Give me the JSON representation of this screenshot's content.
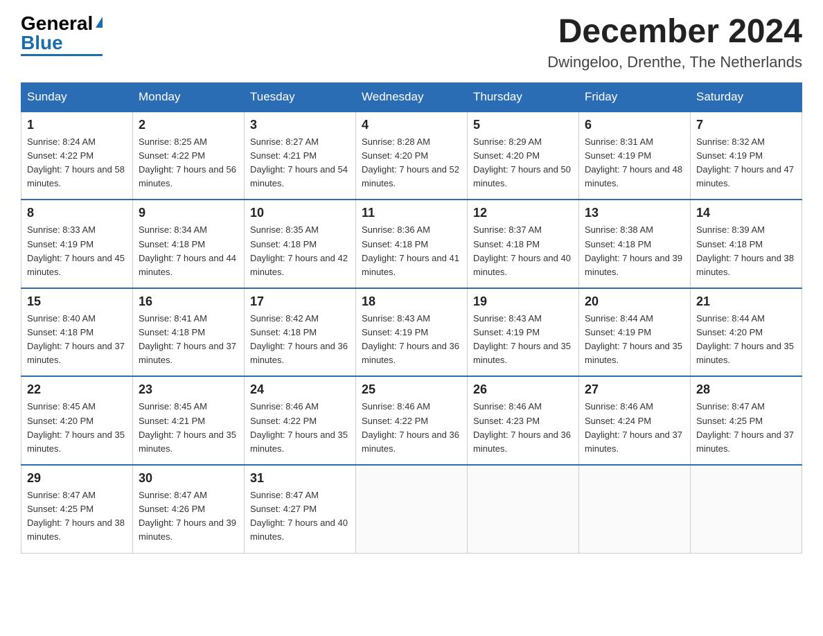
{
  "header": {
    "logo_general": "General",
    "logo_blue": "Blue",
    "month_year": "December 2024",
    "location": "Dwingeloo, Drenthe, The Netherlands"
  },
  "days_of_week": [
    "Sunday",
    "Monday",
    "Tuesday",
    "Wednesday",
    "Thursday",
    "Friday",
    "Saturday"
  ],
  "weeks": [
    [
      {
        "num": "1",
        "sunrise": "Sunrise: 8:24 AM",
        "sunset": "Sunset: 4:22 PM",
        "daylight": "Daylight: 7 hours and 58 minutes."
      },
      {
        "num": "2",
        "sunrise": "Sunrise: 8:25 AM",
        "sunset": "Sunset: 4:22 PM",
        "daylight": "Daylight: 7 hours and 56 minutes."
      },
      {
        "num": "3",
        "sunrise": "Sunrise: 8:27 AM",
        "sunset": "Sunset: 4:21 PM",
        "daylight": "Daylight: 7 hours and 54 minutes."
      },
      {
        "num": "4",
        "sunrise": "Sunrise: 8:28 AM",
        "sunset": "Sunset: 4:20 PM",
        "daylight": "Daylight: 7 hours and 52 minutes."
      },
      {
        "num": "5",
        "sunrise": "Sunrise: 8:29 AM",
        "sunset": "Sunset: 4:20 PM",
        "daylight": "Daylight: 7 hours and 50 minutes."
      },
      {
        "num": "6",
        "sunrise": "Sunrise: 8:31 AM",
        "sunset": "Sunset: 4:19 PM",
        "daylight": "Daylight: 7 hours and 48 minutes."
      },
      {
        "num": "7",
        "sunrise": "Sunrise: 8:32 AM",
        "sunset": "Sunset: 4:19 PM",
        "daylight": "Daylight: 7 hours and 47 minutes."
      }
    ],
    [
      {
        "num": "8",
        "sunrise": "Sunrise: 8:33 AM",
        "sunset": "Sunset: 4:19 PM",
        "daylight": "Daylight: 7 hours and 45 minutes."
      },
      {
        "num": "9",
        "sunrise": "Sunrise: 8:34 AM",
        "sunset": "Sunset: 4:18 PM",
        "daylight": "Daylight: 7 hours and 44 minutes."
      },
      {
        "num": "10",
        "sunrise": "Sunrise: 8:35 AM",
        "sunset": "Sunset: 4:18 PM",
        "daylight": "Daylight: 7 hours and 42 minutes."
      },
      {
        "num": "11",
        "sunrise": "Sunrise: 8:36 AM",
        "sunset": "Sunset: 4:18 PM",
        "daylight": "Daylight: 7 hours and 41 minutes."
      },
      {
        "num": "12",
        "sunrise": "Sunrise: 8:37 AM",
        "sunset": "Sunset: 4:18 PM",
        "daylight": "Daylight: 7 hours and 40 minutes."
      },
      {
        "num": "13",
        "sunrise": "Sunrise: 8:38 AM",
        "sunset": "Sunset: 4:18 PM",
        "daylight": "Daylight: 7 hours and 39 minutes."
      },
      {
        "num": "14",
        "sunrise": "Sunrise: 8:39 AM",
        "sunset": "Sunset: 4:18 PM",
        "daylight": "Daylight: 7 hours and 38 minutes."
      }
    ],
    [
      {
        "num": "15",
        "sunrise": "Sunrise: 8:40 AM",
        "sunset": "Sunset: 4:18 PM",
        "daylight": "Daylight: 7 hours and 37 minutes."
      },
      {
        "num": "16",
        "sunrise": "Sunrise: 8:41 AM",
        "sunset": "Sunset: 4:18 PM",
        "daylight": "Daylight: 7 hours and 37 minutes."
      },
      {
        "num": "17",
        "sunrise": "Sunrise: 8:42 AM",
        "sunset": "Sunset: 4:18 PM",
        "daylight": "Daylight: 7 hours and 36 minutes."
      },
      {
        "num": "18",
        "sunrise": "Sunrise: 8:43 AM",
        "sunset": "Sunset: 4:19 PM",
        "daylight": "Daylight: 7 hours and 36 minutes."
      },
      {
        "num": "19",
        "sunrise": "Sunrise: 8:43 AM",
        "sunset": "Sunset: 4:19 PM",
        "daylight": "Daylight: 7 hours and 35 minutes."
      },
      {
        "num": "20",
        "sunrise": "Sunrise: 8:44 AM",
        "sunset": "Sunset: 4:19 PM",
        "daylight": "Daylight: 7 hours and 35 minutes."
      },
      {
        "num": "21",
        "sunrise": "Sunrise: 8:44 AM",
        "sunset": "Sunset: 4:20 PM",
        "daylight": "Daylight: 7 hours and 35 minutes."
      }
    ],
    [
      {
        "num": "22",
        "sunrise": "Sunrise: 8:45 AM",
        "sunset": "Sunset: 4:20 PM",
        "daylight": "Daylight: 7 hours and 35 minutes."
      },
      {
        "num": "23",
        "sunrise": "Sunrise: 8:45 AM",
        "sunset": "Sunset: 4:21 PM",
        "daylight": "Daylight: 7 hours and 35 minutes."
      },
      {
        "num": "24",
        "sunrise": "Sunrise: 8:46 AM",
        "sunset": "Sunset: 4:22 PM",
        "daylight": "Daylight: 7 hours and 35 minutes."
      },
      {
        "num": "25",
        "sunrise": "Sunrise: 8:46 AM",
        "sunset": "Sunset: 4:22 PM",
        "daylight": "Daylight: 7 hours and 36 minutes."
      },
      {
        "num": "26",
        "sunrise": "Sunrise: 8:46 AM",
        "sunset": "Sunset: 4:23 PM",
        "daylight": "Daylight: 7 hours and 36 minutes."
      },
      {
        "num": "27",
        "sunrise": "Sunrise: 8:46 AM",
        "sunset": "Sunset: 4:24 PM",
        "daylight": "Daylight: 7 hours and 37 minutes."
      },
      {
        "num": "28",
        "sunrise": "Sunrise: 8:47 AM",
        "sunset": "Sunset: 4:25 PM",
        "daylight": "Daylight: 7 hours and 37 minutes."
      }
    ],
    [
      {
        "num": "29",
        "sunrise": "Sunrise: 8:47 AM",
        "sunset": "Sunset: 4:25 PM",
        "daylight": "Daylight: 7 hours and 38 minutes."
      },
      {
        "num": "30",
        "sunrise": "Sunrise: 8:47 AM",
        "sunset": "Sunset: 4:26 PM",
        "daylight": "Daylight: 7 hours and 39 minutes."
      },
      {
        "num": "31",
        "sunrise": "Sunrise: 8:47 AM",
        "sunset": "Sunset: 4:27 PM",
        "daylight": "Daylight: 7 hours and 40 minutes."
      },
      null,
      null,
      null,
      null
    ]
  ]
}
